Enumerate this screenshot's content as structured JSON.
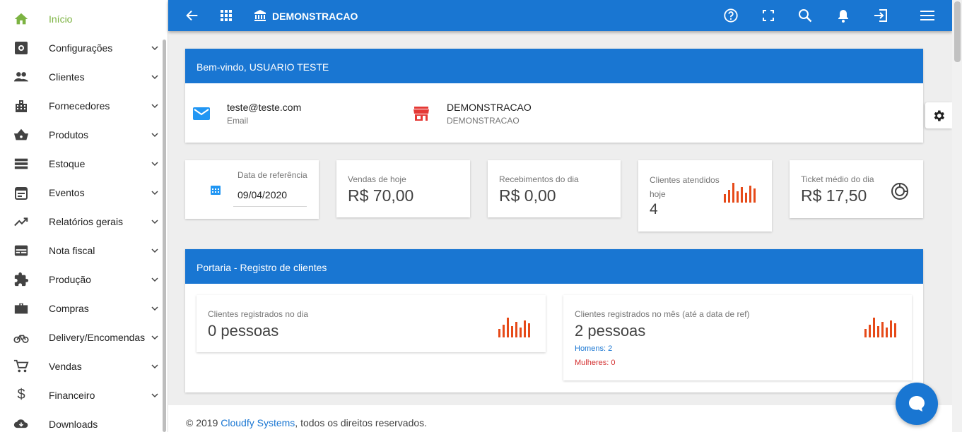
{
  "colors": {
    "primary": "#1976d2",
    "active": "#7cb342",
    "chart": "#e64a19",
    "danger": "#d32f2f"
  },
  "sidebar": {
    "items": [
      {
        "label": "Início",
        "icon": "home-icon"
      },
      {
        "label": "Configurações",
        "icon": "settings-box-icon"
      },
      {
        "label": "Clientes",
        "icon": "people-icon"
      },
      {
        "label": "Fornecedores",
        "icon": "building-icon"
      },
      {
        "label": "Produtos",
        "icon": "basket-icon"
      },
      {
        "label": "Estoque",
        "icon": "list-icon"
      },
      {
        "label": "Eventos",
        "icon": "calendar-icon"
      },
      {
        "label": "Relatórios gerais",
        "icon": "trending-icon"
      },
      {
        "label": "Nota fiscal",
        "icon": "card-icon"
      },
      {
        "label": "Produção",
        "icon": "puzzle-icon"
      },
      {
        "label": "Compras",
        "icon": "briefcase-icon"
      },
      {
        "label": "Delivery/Encomendas",
        "icon": "bike-icon"
      },
      {
        "label": "Vendas",
        "icon": "cart-icon"
      },
      {
        "label": "Financeiro",
        "icon": "dollar-icon"
      },
      {
        "label": "Downloads",
        "icon": "cloud-download-icon"
      }
    ]
  },
  "topbar": {
    "title": "DEMONSTRACAO"
  },
  "welcome": {
    "header": "Bem-vindo, USUARIO TESTE",
    "email_value": "teste@teste.com",
    "email_label": "Email",
    "store_value": "DEMONSTRACAO",
    "store_label": "DEMONSTRACAO"
  },
  "stats": {
    "date_label": "Data de referência",
    "date_value": "09/04/2020",
    "sales_label": "Vendas de hoje",
    "sales_value": "R$ 70,00",
    "receipts_label": "Recebimentos do dia",
    "receipts_value": "R$ 0,00",
    "clients_label": "Clientes atendidos hoje",
    "clients_value": "4",
    "ticket_label": "Ticket médio do dia",
    "ticket_value": "R$ 17,50"
  },
  "portaria": {
    "header": "Portaria - Registro de clientes",
    "day_label": "Clientes registrados no dia",
    "day_value": "0 pessoas",
    "month_label": "Clientes registrados no mês (até a data de ref)",
    "month_value": "2 pessoas",
    "men": "Homens: 2",
    "women": "Mulheres: 0"
  },
  "footer": {
    "prefix": "© 2019 ",
    "link": "Cloudfy Systems",
    "suffix": ", todos os direitos reservados."
  }
}
